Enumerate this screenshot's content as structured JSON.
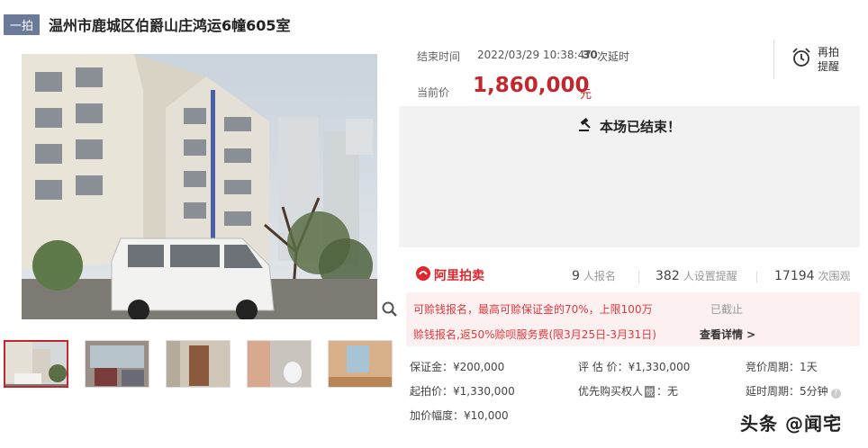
{
  "header": {
    "tag": "一拍",
    "title": "温州市鹿城区伯爵山庄鸿运6幢605室"
  },
  "auction": {
    "end_label": "结束时间",
    "end_time": "2022/03/29 10:38:47",
    "delay_count": "30",
    "delay_label": "次延时",
    "price_label": "当前价",
    "price": "1,860,000",
    "price_unit": "元",
    "remind_label": "再拍提醒",
    "ended_text": "本场已结束！"
  },
  "stats": {
    "logo_text": "阿里拍卖",
    "signups_value": "9",
    "signups_label": "人报名",
    "reminders_value": "382",
    "reminders_label": "人设置提醒",
    "views_value": "17194",
    "views_label": "次围观"
  },
  "promo": {
    "line1": "可赊钱报名，最高可赊保证金的70%，上限100万",
    "line1_status": "已截止",
    "line2": "赊钱报名,返50%赊呗服务费(限3月25日-3月31日)",
    "line2_link": "查看详情 >"
  },
  "details": {
    "deposit": "保证金：¥200,000",
    "appraisal": "评 估 价：¥1,330,000",
    "bid_cycle": "竞价周期：1天",
    "start_price": "起拍价：¥1,330,000",
    "priority_label": "优先购买权人",
    "priority_badge": "悦",
    "priority_value": "：无",
    "delay_cycle": "延时周期：5分钟",
    "increment": "加价幅度：¥10,000"
  },
  "watermark": "头条 @闻宅",
  "icons": {
    "zoom": "search-icon",
    "alarm": "alarm-clock-icon",
    "gavel": "gavel-icon",
    "logo": "ali-auction-logo-icon",
    "help": "help-icon"
  }
}
